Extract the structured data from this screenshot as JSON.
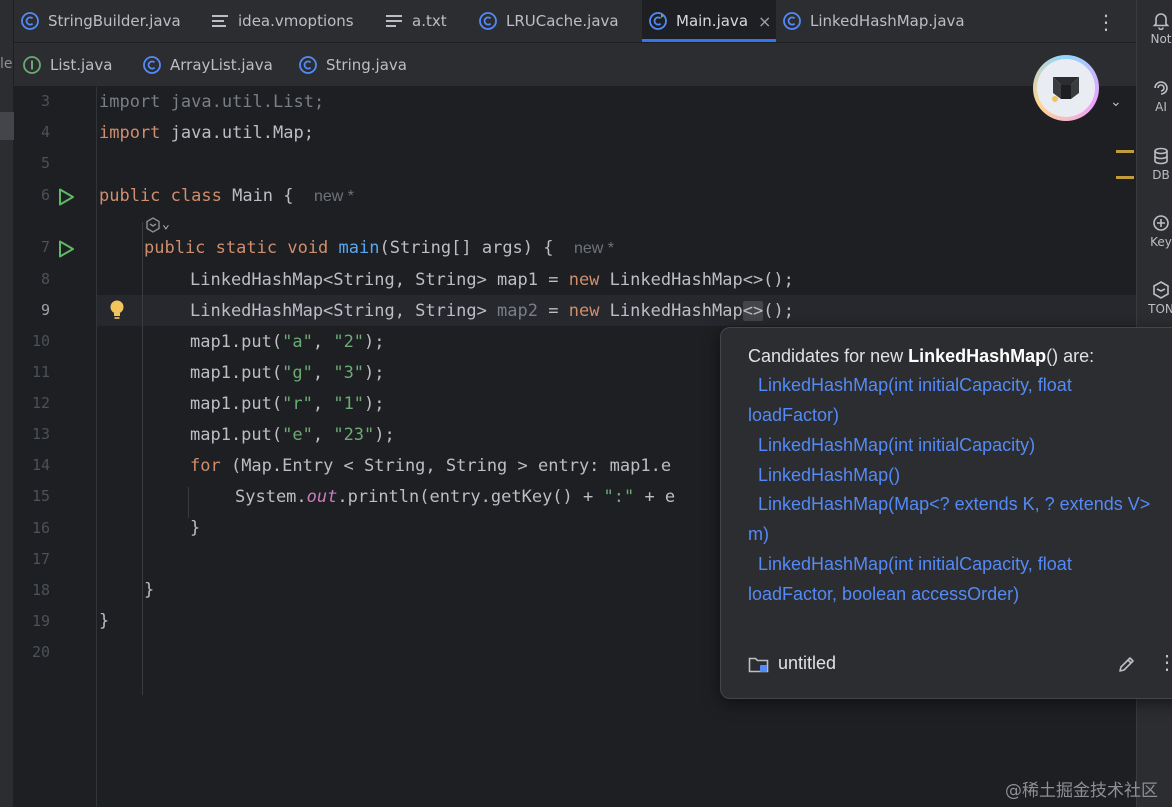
{
  "tabs_row1": [
    {
      "label": "StringBuilder.java",
      "icon": "class-icon",
      "active": false
    },
    {
      "label": "idea.vmoptions",
      "icon": "config-file-icon",
      "active": false
    },
    {
      "label": "a.txt",
      "icon": "text-file-icon",
      "active": false
    },
    {
      "label": "LRUCache.java",
      "icon": "class-icon",
      "active": false
    },
    {
      "label": "Main.java",
      "icon": "class-icon",
      "active": true,
      "close": "×"
    },
    {
      "label": "LinkedHashMap.java",
      "icon": "class-icon",
      "active": false
    }
  ],
  "tabs_row2": [
    {
      "label": "List.java",
      "icon": "interface-icon"
    },
    {
      "label": "ArrayList.java",
      "icon": "class-icon"
    },
    {
      "label": "String.java",
      "icon": "class-icon"
    }
  ],
  "left_strip_fragment": "le",
  "more_menu": "⋮",
  "right_tools": [
    {
      "label": "Not",
      "icon": "notifications-icon"
    },
    {
      "label": "AI",
      "icon": "ai-assistant-icon"
    },
    {
      "label": "DB",
      "icon": "database-icon"
    },
    {
      "label": "Key",
      "icon": "key-promoter-icon"
    },
    {
      "label": "TON",
      "icon": "tongyi-icon"
    }
  ],
  "ai_chevron": "⌄",
  "line_numbers": [
    "3",
    "4",
    "5",
    "6",
    "7",
    "8",
    "9",
    "10",
    "11",
    "12",
    "13",
    "14",
    "15",
    "16",
    "17",
    "18",
    "19",
    "20"
  ],
  "current_line": "9",
  "code": {
    "l3": {
      "kw": "import",
      "rest": " java.util.List;"
    },
    "l4": {
      "kw": "import",
      "rest": " java.util.Map;"
    },
    "l6": {
      "kw1": "public",
      "kw2": "class",
      "rest": " Main {",
      "hint": "new *"
    },
    "l6b": {
      "chevron": "⌄"
    },
    "l7": {
      "kw1": "public",
      "kw2": "static",
      "kw3": "void",
      "fn": "main",
      "rest": "(String[] args) {",
      "hint": "new *"
    },
    "l8": {
      "a": "LinkedHashMap<String, String> map1 = ",
      "kw": "new",
      "b": " LinkedHashMap<>();"
    },
    "l9": {
      "a": "LinkedHashMap<String, String> ",
      "var": "map2",
      "b": " = ",
      "kw": "new",
      "c": " LinkedHashMap",
      "brace": "<>",
      "d": "();"
    },
    "l10": {
      "a": "map1.put(",
      "s1": "\"a\"",
      "b": ", ",
      "s2": "\"2\"",
      "c": ");"
    },
    "l11": {
      "a": "map1.put(",
      "s1": "\"g\"",
      "b": ", ",
      "s2": "\"3\"",
      "c": ");"
    },
    "l12": {
      "a": "map1.put(",
      "s1": "\"r\"",
      "b": ", ",
      "s2": "\"1\"",
      "c": ");"
    },
    "l13": {
      "a": "map1.put(",
      "s1": "\"e\"",
      "b": ", ",
      "s2": "\"23\"",
      "c": ");"
    },
    "l14": {
      "kw": "for",
      "rest": " (Map.Entry < String, String > entry: map1.e"
    },
    "l15": {
      "a": "System.",
      "stat": "out",
      "b": ".println(entry.getKey() + ",
      "s": "\":\"",
      "c": " + e"
    },
    "l16": {
      "text": "}"
    },
    "l18": {
      "text": "}"
    },
    "l19": {
      "text": "}"
    }
  },
  "popup": {
    "title_prefix": "Candidates for new ",
    "title_bold": "LinkedHashMap",
    "title_suffix": "() are:",
    "candidates": [
      "LinkedHashMap(int initialCapacity, float",
      "loadFactor)",
      "LinkedHashMap(int initialCapacity)",
      "LinkedHashMap()",
      "LinkedHashMap(Map<? extends K, ? extends V>",
      "m)",
      "LinkedHashMap(int initialCapacity, float",
      "loadFactor, boolean accessOrder)"
    ],
    "footer_label": "untitled",
    "more": "⋮"
  },
  "watermark": "@稀土掘金技术社区",
  "colors": {
    "background": "#1e1f22",
    "panel": "#2b2d30",
    "keyword": "#cf8e6d",
    "string": "#6aab73",
    "function": "#56a8f5",
    "link": "#548af7",
    "accent": "#3574f0"
  }
}
